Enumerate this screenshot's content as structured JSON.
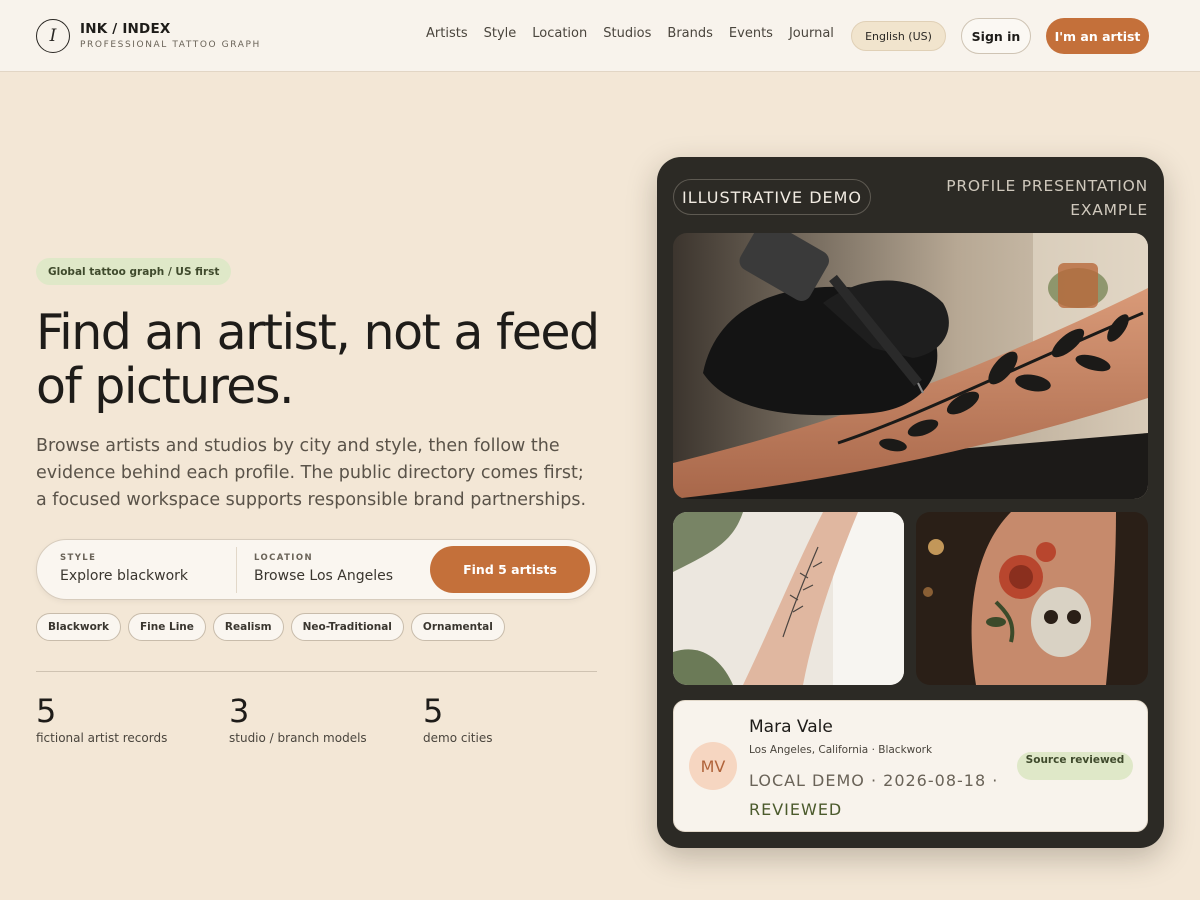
{
  "brand": {
    "mark": "I",
    "title": "INK / INDEX",
    "subtitle": "PROFESSIONAL TATTOO GRAPH"
  },
  "nav": [
    "Artists",
    "Style",
    "Location",
    "Studios",
    "Brands",
    "Events",
    "Journal"
  ],
  "header": {
    "language": "English (US)",
    "sign_in": "Sign in",
    "artist_cta": "I'm an artist"
  },
  "hero": {
    "tag": "Global tattoo graph / US first",
    "title": "Find an artist, not a feed of pictures.",
    "description": "Browse artists and studios by city and style, then follow the evidence behind each profile. The public directory comes first; a focused workspace supports responsible brand partnerships."
  },
  "search": {
    "style_label": "STYLE",
    "style_value": "Explore blackwork",
    "location_label": "LOCATION",
    "location_value": "Browse Los Angeles",
    "button": "Find 5 artists"
  },
  "chips": [
    "Blackwork",
    "Fine Line",
    "Realism",
    "Neo-Traditional",
    "Ornamental"
  ],
  "stats": [
    {
      "value": "5",
      "label": "fictional artist records"
    },
    {
      "value": "3",
      "label": "studio / branch models"
    },
    {
      "value": "5",
      "label": "demo cities"
    }
  ],
  "card": {
    "badge": "ILLUSTRATIVE DEMO",
    "caption": "PROFILE PRESENTATION EXAMPLE",
    "profile": {
      "initials": "MV",
      "name": "Mara Vale",
      "location": "Los Angeles, California · Blackwork",
      "meta": "LOCAL DEMO · 2026-08-18 ·",
      "status": "REVIEWED",
      "source_badge": "Source reviewed"
    }
  },
  "colors": {
    "accent": "#c4703a",
    "background": "#f3e7d6",
    "card": "#2c2a25",
    "green_badge": "#dfe8c8"
  }
}
